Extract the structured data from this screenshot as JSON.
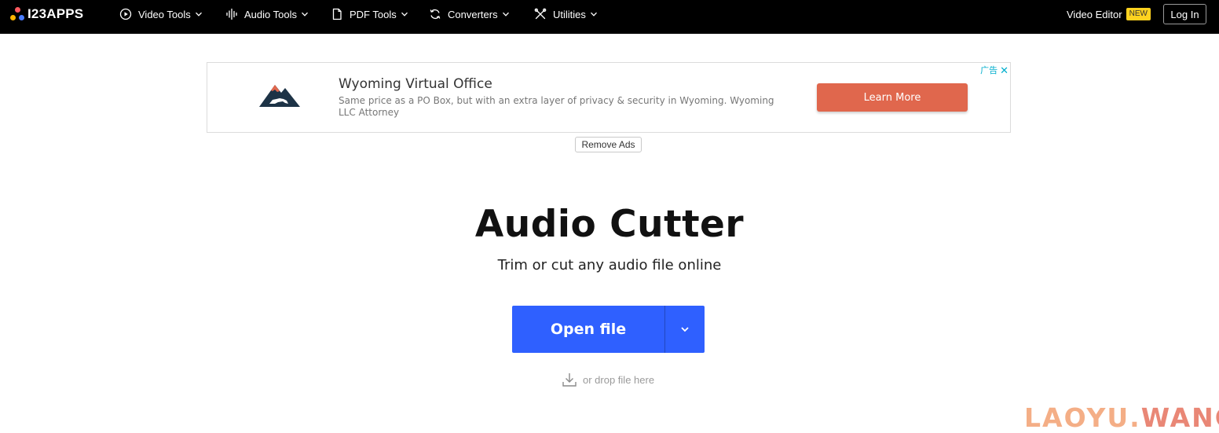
{
  "brand": {
    "name": "I23APPS",
    "dot_colors": [
      "#ff5a5f",
      "#ffb400",
      "#4a7cff"
    ]
  },
  "nav": {
    "items": [
      {
        "label": "Video Tools",
        "icon": "video-play-icon"
      },
      {
        "label": "Audio Tools",
        "icon": "audio-wave-icon"
      },
      {
        "label": "PDF Tools",
        "icon": "pdf-document-icon"
      },
      {
        "label": "Converters",
        "icon": "convert-cycle-icon"
      },
      {
        "label": "Utilities",
        "icon": "tools-icon"
      }
    ],
    "video_editor_label": "Video Editor",
    "new_badge": "NEW",
    "login_label": "Log In"
  },
  "ad": {
    "title": "Wyoming Virtual Office",
    "description": "Same price as a PO Box, but with an extra layer of privacy & security in Wyoming. Wyoming LLC Attorney",
    "cta": "Learn More",
    "ad_label": "广告",
    "remove_ads": "Remove Ads"
  },
  "hero": {
    "title": "Audio Cutter",
    "subtitle": "Trim or cut any audio file online",
    "open_file": "Open file",
    "drop_hint": "or drop file here"
  },
  "watermark": {
    "part1": "LAOYU.",
    "part2": "WANG"
  },
  "colors": {
    "topbar": "#000000",
    "primary_button": "#2f60ff",
    "ad_cta": "#e0674d",
    "new_badge": "#ffd21f",
    "watermark": "#f3a071"
  }
}
